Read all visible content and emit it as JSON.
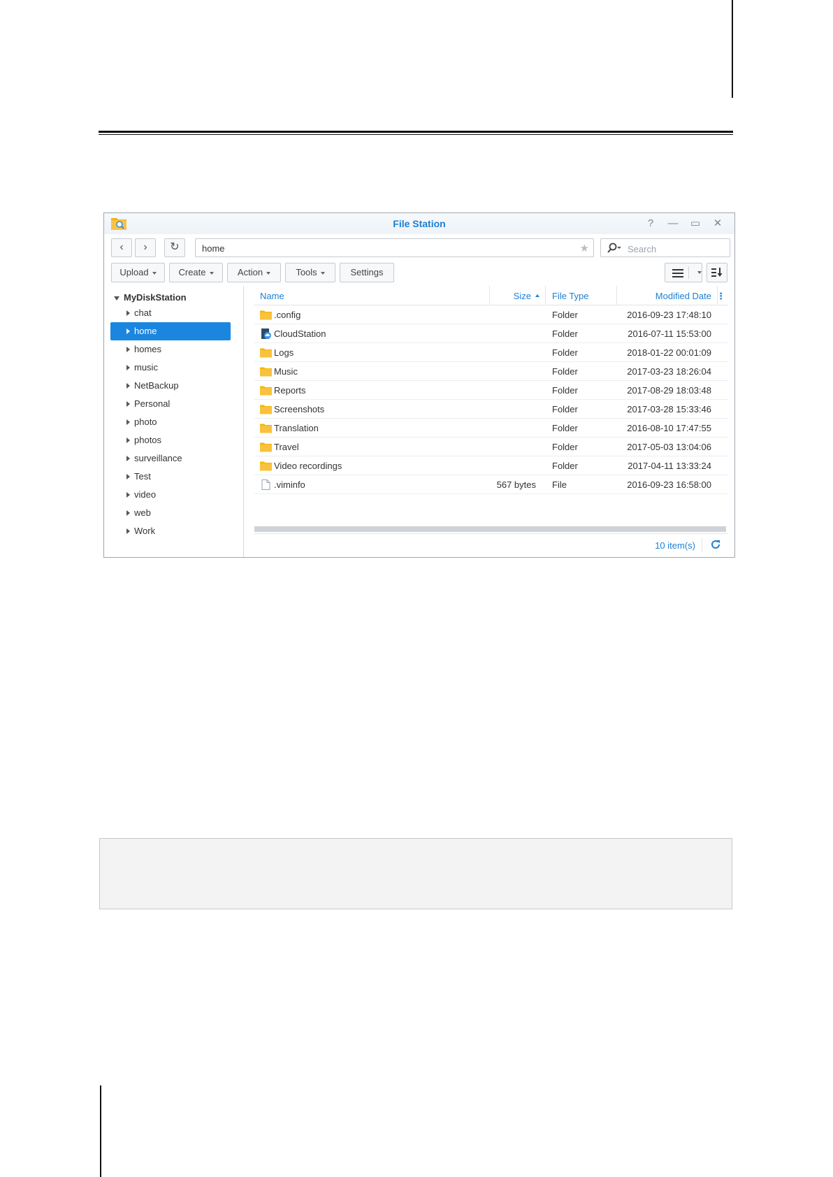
{
  "window": {
    "title": "File Station",
    "controls": [
      "?",
      "—",
      "▭",
      "✕"
    ]
  },
  "navbar": {
    "back": "‹",
    "forward": "›",
    "refresh": "↻",
    "path": "home",
    "search_placeholder": "Search"
  },
  "toolbar": {
    "upload": "Upload",
    "create": "Create",
    "action": "Action",
    "tools": "Tools",
    "settings": "Settings"
  },
  "sidebar": {
    "root": "MyDiskStation",
    "items": [
      "chat",
      "home",
      "homes",
      "music",
      "NetBackup",
      "Personal",
      "photo",
      "photos",
      "surveillance",
      "Test",
      "video",
      "web",
      "Work"
    ],
    "selected": "home"
  },
  "columns": {
    "name": "Name",
    "size": "Size",
    "type": "File Type",
    "date": "Modified Date"
  },
  "files": [
    {
      "name": ".config",
      "size": "",
      "type": "Folder",
      "date": "2016-09-23 17:48:10",
      "icon": "folder-icon"
    },
    {
      "name": "CloudStation",
      "size": "",
      "type": "Folder",
      "date": "2016-07-11 15:53:00",
      "icon": "cloud-station-folder-icon"
    },
    {
      "name": "Logs",
      "size": "",
      "type": "Folder",
      "date": "2018-01-22 00:01:09",
      "icon": "folder-icon"
    },
    {
      "name": "Music",
      "size": "",
      "type": "Folder",
      "date": "2017-03-23 18:26:04",
      "icon": "folder-icon"
    },
    {
      "name": "Reports",
      "size": "",
      "type": "Folder",
      "date": "2017-08-29 18:03:48",
      "icon": "folder-icon"
    },
    {
      "name": "Screenshots",
      "size": "",
      "type": "Folder",
      "date": "2017-03-28 15:33:46",
      "icon": "folder-icon"
    },
    {
      "name": "Translation",
      "size": "",
      "type": "Folder",
      "date": "2016-08-10 17:47:55",
      "icon": "folder-icon"
    },
    {
      "name": "Travel",
      "size": "",
      "type": "Folder",
      "date": "2017-05-03 13:04:06",
      "icon": "folder-icon"
    },
    {
      "name": "Video recordings",
      "size": "",
      "type": "Folder",
      "date": "2017-04-11 13:33:24",
      "icon": "folder-icon"
    },
    {
      "name": ".viminfo",
      "size": "567 bytes",
      "type": "File",
      "date": "2016-09-23 16:58:00",
      "icon": "file-icon"
    }
  ],
  "status": {
    "count": "10 item(s)"
  },
  "colors": {
    "accent": "#1d7fd4",
    "selected": "#1a86e0",
    "folder": "#f7b500"
  }
}
